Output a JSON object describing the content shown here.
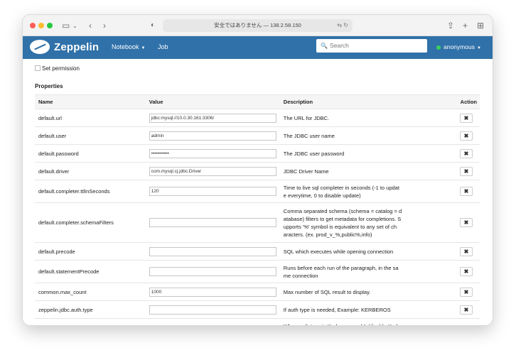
{
  "browser": {
    "url": "安全ではありません — 138.2.58.150"
  },
  "navbar": {
    "brand": "Zeppelin",
    "items": [
      {
        "label": "Notebook"
      },
      {
        "label": "Job"
      }
    ],
    "search_placeholder": "Search",
    "user": "anonymous"
  },
  "interpreter": {
    "set_permission_label": "Set permission",
    "properties_title": "Properties",
    "columns": {
      "name": "Name",
      "value": "Value",
      "description": "Description",
      "action": "Action"
    },
    "remove_label": "✖",
    "rows": [
      {
        "name": "default.url",
        "value": "jdbc:mysql://10.0.30.161:3306/",
        "description_lines": [
          "The URL for JDBC."
        ]
      },
      {
        "name": "default.user",
        "value": "admin",
        "description_lines": [
          "The JDBC user name"
        ]
      },
      {
        "name": "default.password",
        "value": "•••••••••••",
        "description_lines": [
          "The JDBC user password"
        ]
      },
      {
        "name": "default.driver",
        "value": "com.mysql.cj.jdbc.Driver",
        "description_lines": [
          "JDBC Driver Name"
        ]
      },
      {
        "name": "default.completer.ttlInSeconds",
        "value": "120",
        "description_lines": [
          "Time to live sql completer in seconds (-1 to updat",
          "e everytime, 0 to disable update)"
        ]
      },
      {
        "name": "default.completer.schemaFilters",
        "value": "",
        "description_lines": [
          "Comma separated schema (schema = catalog = d",
          "atabase) filters to get metadata for completions. S",
          "upports '%' symbol is equivalent to any set of ch",
          "aracters. (ex. prod_v_%,public%,info)"
        ]
      },
      {
        "name": "default.precode",
        "value": "",
        "description_lines": [
          "SQL which executes while opening connection"
        ]
      },
      {
        "name": "default.statementPrecode",
        "value": "",
        "description_lines": [
          "Runs before each run of the paragraph, in the sa",
          "me connection"
        ]
      },
      {
        "name": "common.max_count",
        "value": "1000",
        "description_lines": [
          "Max number of SQL result to display."
        ]
      },
      {
        "name": "zeppelin.jdbc.auth.type",
        "value": "",
        "description_lines": [
          "If auth type is needed, Example: KERBEROS"
        ]
      },
      {
        "name": "",
        "value": null,
        "description_lines": [
          "When auth type is Kerberos, enable/disable Kerb"
        ]
      }
    ]
  }
}
